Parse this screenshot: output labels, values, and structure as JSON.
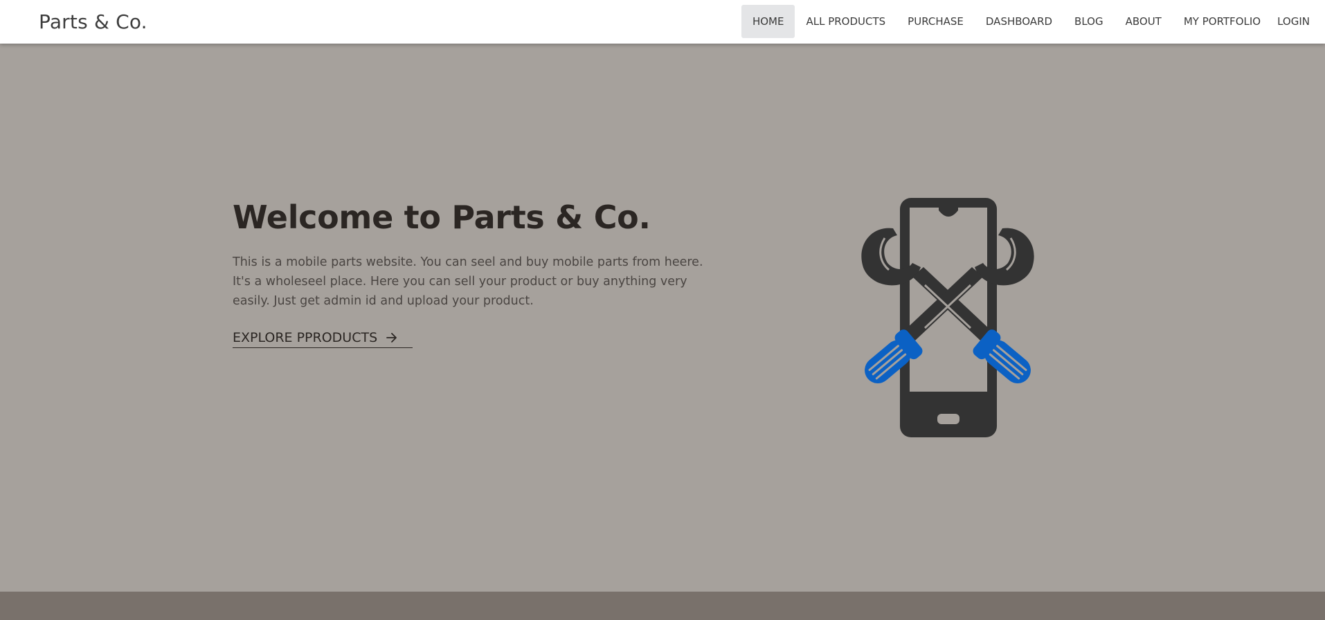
{
  "brand": "Parts & Co.",
  "nav": {
    "items": [
      "HOME",
      "ALL PRODUCTS",
      "PURCHASE",
      "DASHBOARD",
      "BLOG",
      "ABOUT",
      "MY PORTFOLIO"
    ],
    "active": "HOME",
    "login": "LOGIN"
  },
  "hero": {
    "title": "Welcome to Parts & Co.",
    "description": "This is a mobile parts website. You can seel and buy mobile parts from heere. It's a wholeseel place. Here you can sell your product or buy anything very easily. Just get admin id and upload your product.",
    "cta": "EXPLORE PPRODUCTS",
    "cta_icon": "arrow-right-icon",
    "graphic_icon": "phone-repair-tools-icon"
  },
  "colors": {
    "hero_bg": "#a6a19c",
    "footer_bg": "#79716b",
    "dark": "#333333",
    "accent_blue": "#0b61c4"
  }
}
